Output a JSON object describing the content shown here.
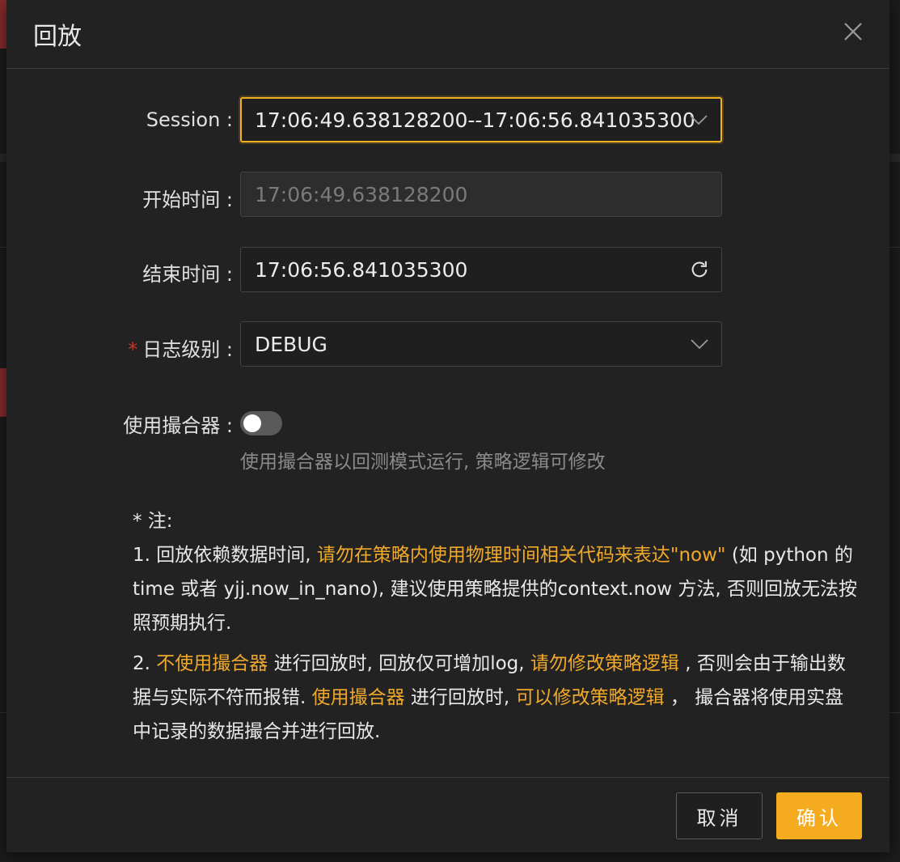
{
  "dialog": {
    "title": "回放",
    "close_label": "×"
  },
  "form": {
    "session": {
      "label": "Session :",
      "value": "17:06:49.638128200--17:06:56.841035300"
    },
    "start_time": {
      "label": "开始时间 :",
      "value": "17:06:49.638128200"
    },
    "end_time": {
      "label": "结束时间 :",
      "value": "17:06:56.841035300"
    },
    "log_level": {
      "required_mark": "*",
      "label": "日志级别 :",
      "value": "DEBUG"
    },
    "use_matcher": {
      "label": "使用撮合器 :",
      "enabled": false,
      "help": "使用撮合器以回测模式运行, 策略逻辑可修改"
    }
  },
  "note": {
    "heading": "* 注:",
    "p1": {
      "a": "1. 回放依赖数据时间, ",
      "b": "请勿在策略内使用物理时间相关代码来表达\"now\"",
      "c": " (如 python 的 time 或者 yjj.now_in_nano), 建议使用策略提供的context.now 方法, 否则回放无法按照预期执行."
    },
    "p2": {
      "a": "2. ",
      "b": "不使用撮合器",
      "c": " 进行回放时, 回放仅可增加log, ",
      "d": "请勿修改策略逻辑",
      "e": " , 否则会由于输出数据与实际不符而报错. ",
      "f": "使用撮合器",
      "g": " 进行回放时, ",
      "h": "可以修改策略逻辑",
      "i": " ， 撮合器将使用实盘中记录的数据撮合并进行回放."
    }
  },
  "footer": {
    "cancel_label": "取消",
    "ok_label": "确认"
  },
  "colors": {
    "accent": "#f5ab1e",
    "highlight_text": "#f0a92a",
    "required": "#c0392b"
  }
}
